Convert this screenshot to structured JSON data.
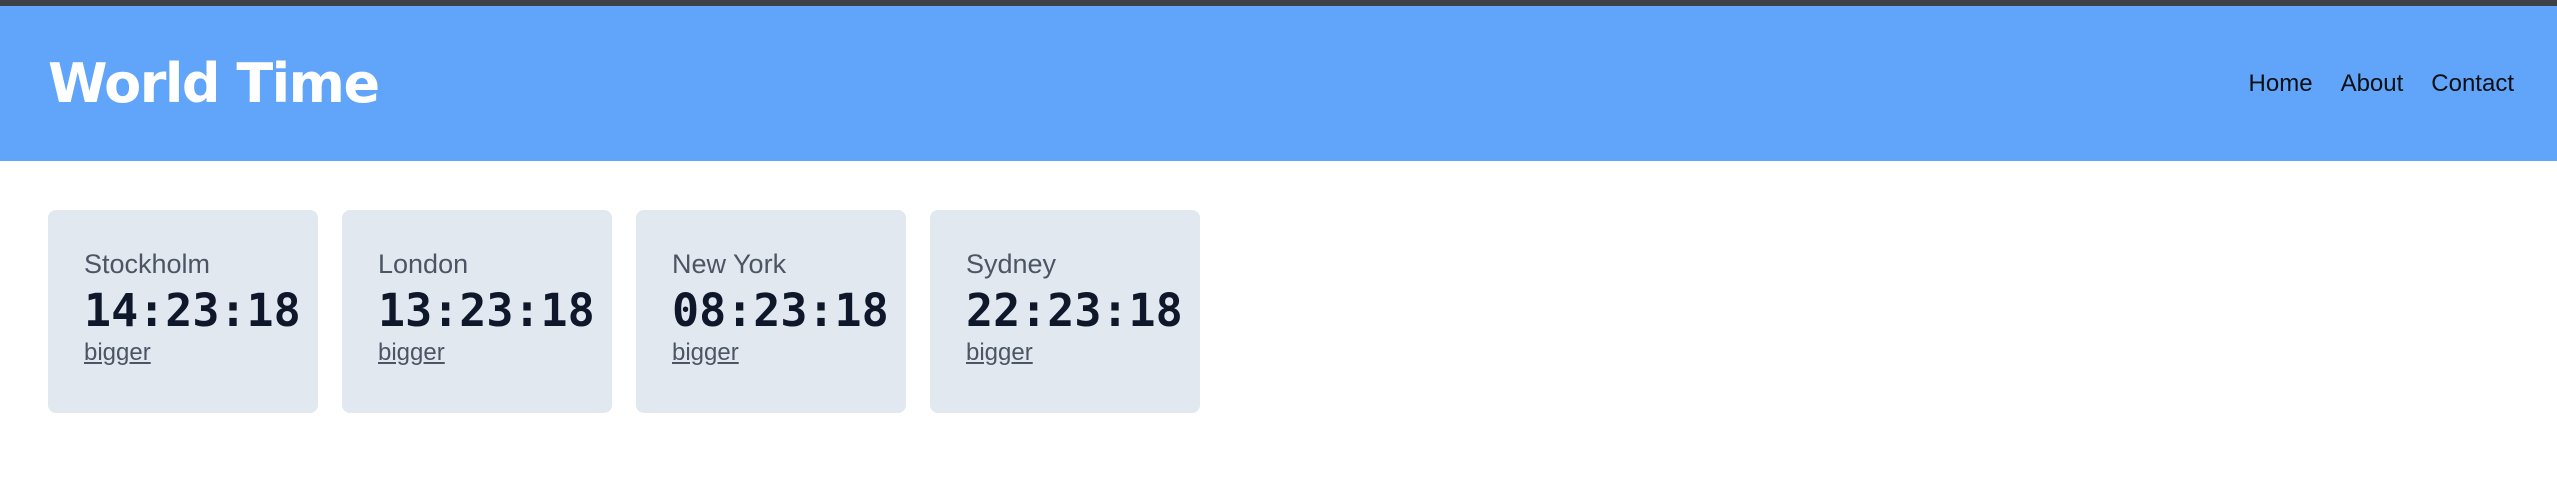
{
  "header": {
    "title": "World Time",
    "nav": [
      {
        "label": "Home"
      },
      {
        "label": "About"
      },
      {
        "label": "Contact"
      }
    ]
  },
  "clocks": [
    {
      "city": "Stockholm",
      "time": "14:23:18",
      "link": "bigger"
    },
    {
      "city": "London",
      "time": "13:23:18",
      "link": "bigger"
    },
    {
      "city": "New York",
      "time": "08:23:18",
      "link": "bigger"
    },
    {
      "city": "Sydney",
      "time": "22:23:18",
      "link": "bigger"
    }
  ],
  "colors": {
    "header_bg": "#60a5fa",
    "card_bg": "#e2e8f0",
    "title": "#ffffff"
  }
}
